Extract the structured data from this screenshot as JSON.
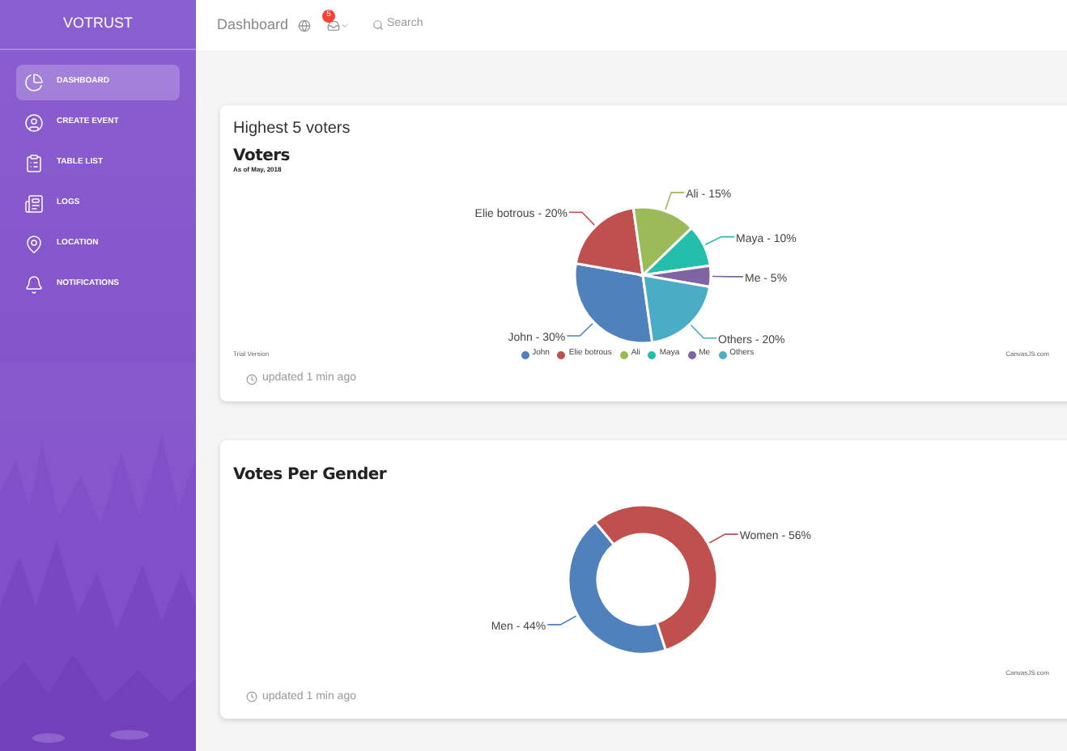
{
  "sidebar": {
    "brand": "VOTRUST",
    "items": [
      {
        "label": "DASHBOARD",
        "selected": true
      },
      {
        "label": "CREATE EVENT",
        "selected": false
      },
      {
        "label": "TABLE LIST",
        "selected": false
      },
      {
        "label": "LOGS",
        "selected": false
      },
      {
        "label": "LOCATION",
        "selected": false
      },
      {
        "label": "NOTIFICATIONS",
        "selected": false
      }
    ]
  },
  "topbar": {
    "title": "Dashboard",
    "notification_count": "5",
    "search": "Search"
  },
  "cards": [
    {
      "heading": "Highest 5 voters",
      "subtitle": "As of May, 2018",
      "trial": "Trial Version",
      "credit": "CanvasJS.com",
      "footer": "updated 1 min ago",
      "legend": [
        "John",
        "Elie botrous",
        "Ali",
        "Maya",
        "Me",
        "Others"
      ],
      "chart_data": {
        "type": "pie",
        "title": "Voters",
        "categories": [
          "John - 30%",
          "Elie botrous - 20%",
          "Ali - 15%",
          "Maya - 10%",
          "Me - 5%",
          "Others - 20%"
        ],
        "values": [
          30,
          20,
          15,
          10,
          5,
          20
        ]
      }
    },
    {
      "credit": "CanvasJS.com",
      "footer": "updated 1 min ago",
      "chart_data": {
        "type": "donut",
        "title": "Votes Per Gender",
        "categories": [
          "Men - 44%",
          "Women - 56%"
        ],
        "values": [
          44,
          56
        ]
      }
    }
  ]
}
